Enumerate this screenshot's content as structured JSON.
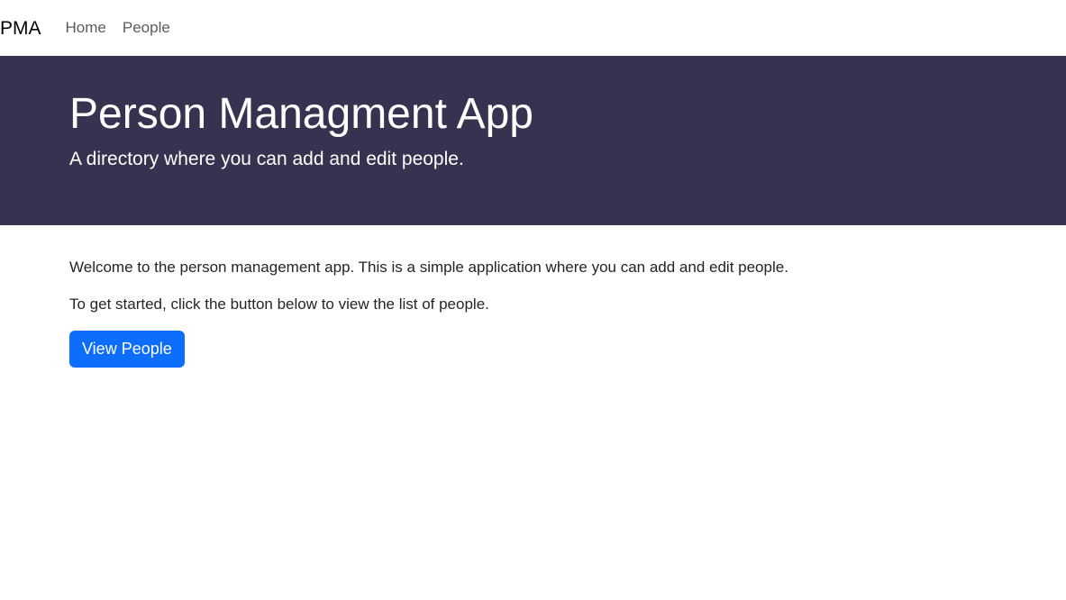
{
  "navbar": {
    "brand": "PMA",
    "links": [
      {
        "label": "Home"
      },
      {
        "label": "People"
      }
    ]
  },
  "hero": {
    "title": "Person Managment App",
    "subtitle": "A directory where you can add and edit people.",
    "background_color": "#383251"
  },
  "main": {
    "welcome_text": "Welcome to the person management app. This is a simple application where you can add and edit people.",
    "instructions_text": "To get started, click the button below to view the list of people.",
    "view_people_button": "View People",
    "button_color": "#0d6efd"
  }
}
